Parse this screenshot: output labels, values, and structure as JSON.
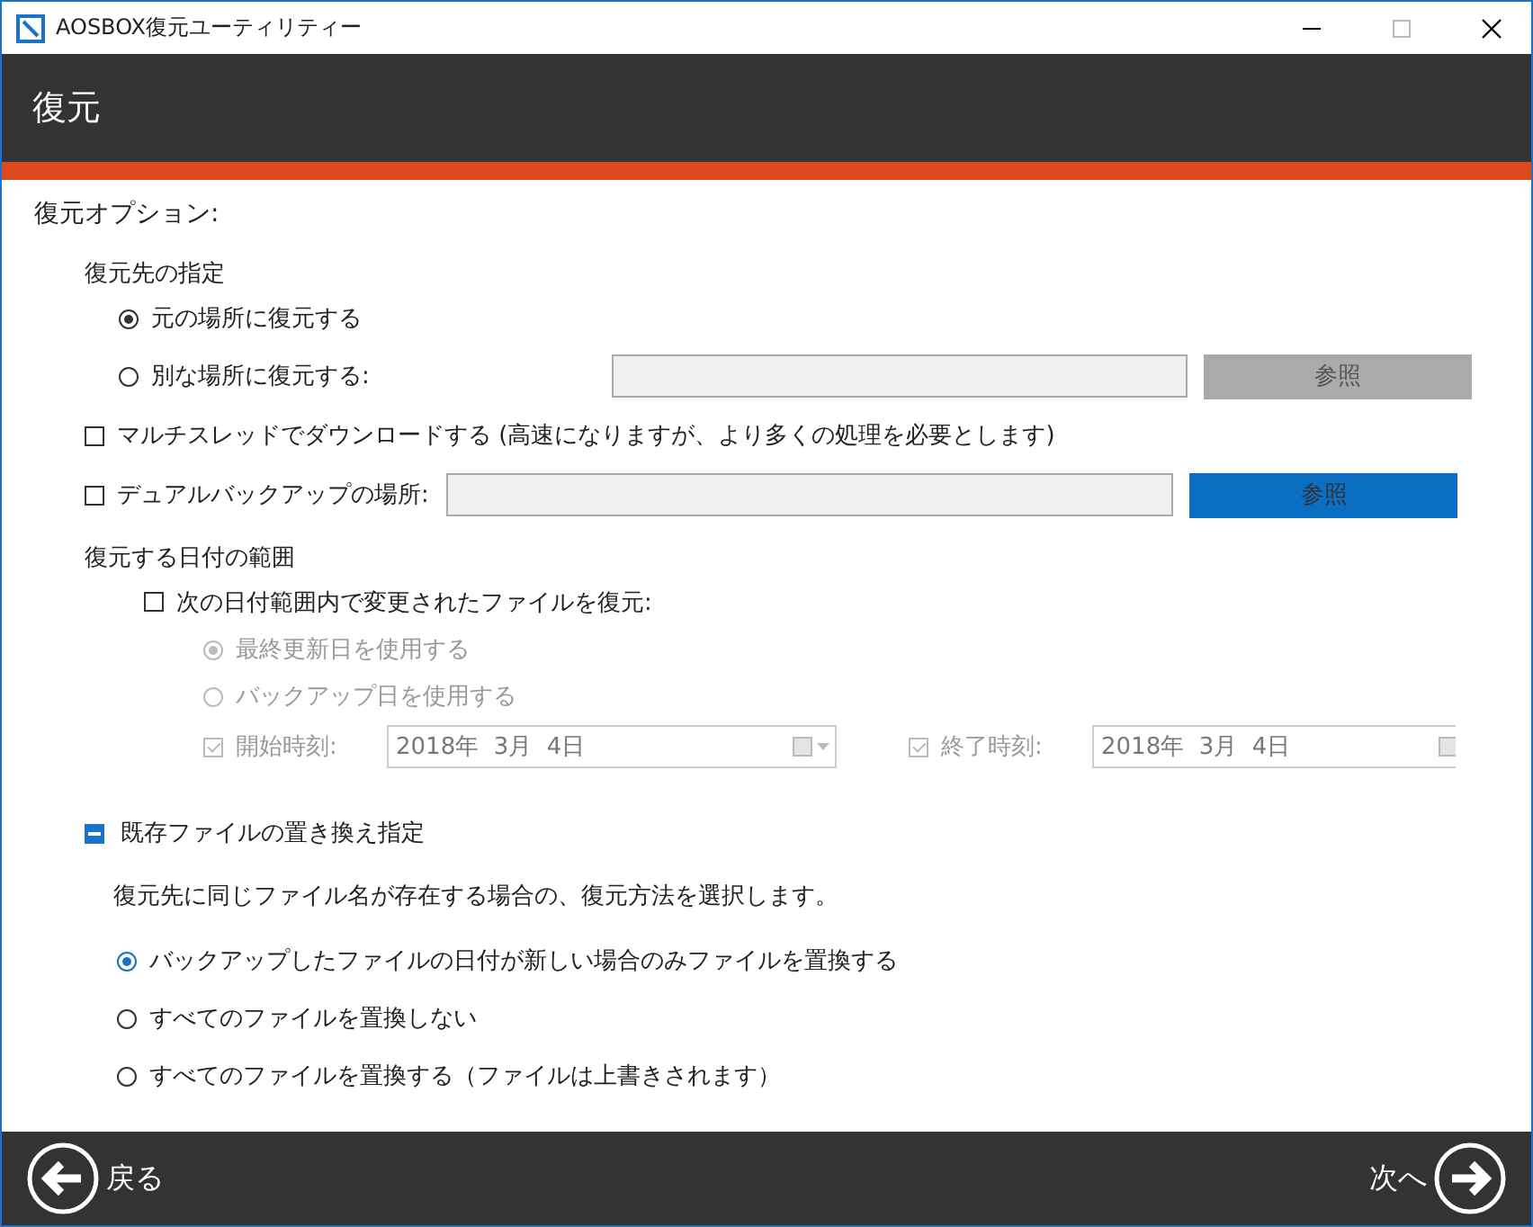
{
  "window": {
    "title": "AOSBOX復元ユーティリティー"
  },
  "header": {
    "title": "復元"
  },
  "options_label": "復元オプション:",
  "destination": {
    "label": "復元先の指定",
    "options": [
      {
        "label": "元の場所に復元する",
        "selected": true
      },
      {
        "label": "別な場所に復元する:",
        "selected": false
      }
    ],
    "browse_button": {
      "label": "参照",
      "disabled": true
    }
  },
  "multithread": {
    "label": "マルチスレッドでダウンロードする (高速になりますが、より多くの処理を必要とします)",
    "checked": false
  },
  "dual_backup": {
    "label": "デュアルバックアップの場所:",
    "checked": false,
    "browse_button": {
      "label": "参照",
      "disabled": false
    }
  },
  "date_range": {
    "label": "復元する日付の範囲",
    "filter": {
      "label": "次の日付範囲内で変更されたファイルを復元:",
      "checked": false
    },
    "basis_options": [
      {
        "label": "最終更新日を使用する",
        "selected": true,
        "disabled": true
      },
      {
        "label": "バックアップ日を使用する",
        "selected": false,
        "disabled": true
      }
    ],
    "start": {
      "label": "開始時刻:",
      "checked": true,
      "disabled": true,
      "value": "2018年  3月  4日"
    },
    "end": {
      "label": "終了時刻:",
      "checked": true,
      "disabled": true,
      "value": "2018年  3月  4日"
    }
  },
  "replace_section": {
    "title": "既存ファイルの置き換え指定",
    "expanded": true,
    "description": "復元先に同じファイル名が存在する場合の、復元方法を選択します。",
    "options": [
      {
        "label": "バックアップしたファイルの日付が新しい場合のみファイルを置換する",
        "selected": true
      },
      {
        "label": "すべてのファイルを置換しない",
        "selected": false
      },
      {
        "label": "すべてのファイルを置換する（ファイルは上書きされます）",
        "selected": false
      }
    ]
  },
  "footer": {
    "back_button": {
      "label": "戻る"
    },
    "next_button": {
      "label": "次へ"
    }
  }
}
